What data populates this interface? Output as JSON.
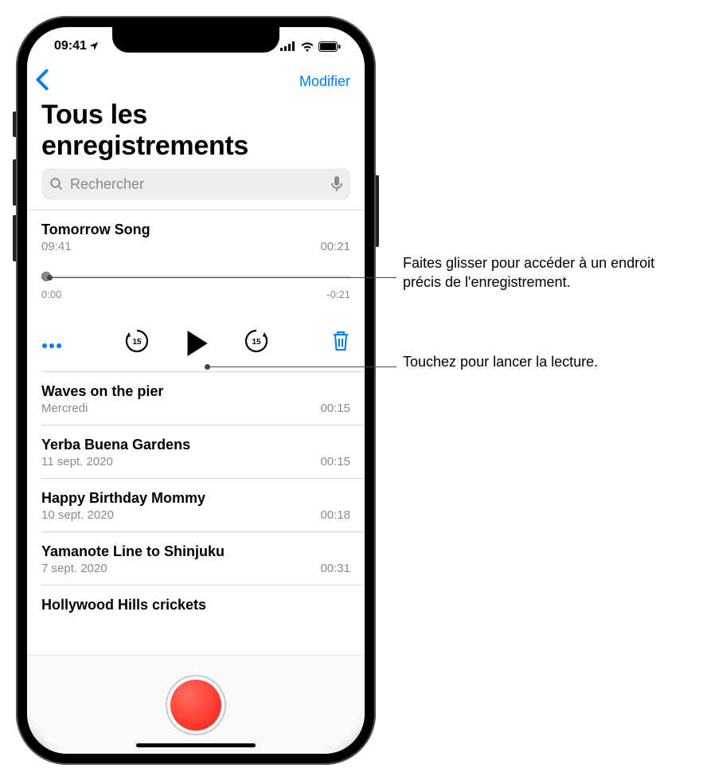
{
  "status": {
    "time": "09:41"
  },
  "nav": {
    "edit": "Modifier"
  },
  "page": {
    "title": "Tous les enregistrements"
  },
  "search": {
    "placeholder": "Rechercher"
  },
  "selected": {
    "title": "Tomorrow Song",
    "time": "09:41",
    "duration": "00:21",
    "scrub_start": "0:00",
    "scrub_end": "-0:21"
  },
  "skip": {
    "back_seconds": "15",
    "fwd_seconds": "15"
  },
  "recordings": [
    {
      "title": "Waves on the pier",
      "date": "Mercredi",
      "duration": "00:15"
    },
    {
      "title": "Yerba Buena Gardens",
      "date": "11 sept. 2020",
      "duration": "00:15"
    },
    {
      "title": "Happy Birthday Mommy",
      "date": "10 sept. 2020",
      "duration": "00:18"
    },
    {
      "title": "Yamanote Line to Shinjuku",
      "date": "7 sept. 2020",
      "duration": "00:31"
    },
    {
      "title": "Hollywood Hills crickets",
      "date": "",
      "duration": ""
    }
  ],
  "callouts": {
    "scrubber": "Faites glisser pour accéder à un endroit précis de l'enregistrement.",
    "play": "Touchez pour lancer la lecture."
  }
}
